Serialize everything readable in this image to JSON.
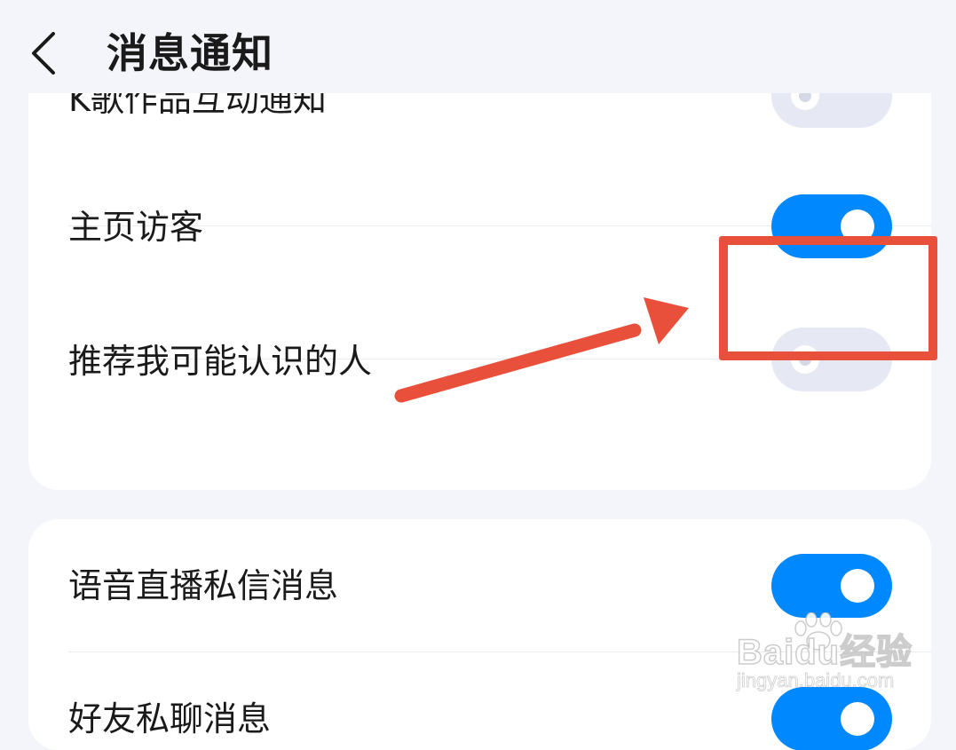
{
  "header": {
    "title": "消息通知"
  },
  "settings_group_1": [
    {
      "label": "K歌作品互动通知",
      "enabled": false
    },
    {
      "label": "主页访客",
      "enabled": true
    },
    {
      "label": "推荐我可能认识的人",
      "enabled": false
    }
  ],
  "settings_group_2": [
    {
      "label": "语音直播私信消息",
      "enabled": true
    },
    {
      "label": "好友私聊消息",
      "enabled": true
    }
  ],
  "colors": {
    "toggle_on": "#0088ff",
    "toggle_off": "#e6e8f3",
    "annotation": "#e8503c"
  },
  "watermark": {
    "brand": "Baidu经验",
    "url": "jingyan.baidu.com"
  }
}
